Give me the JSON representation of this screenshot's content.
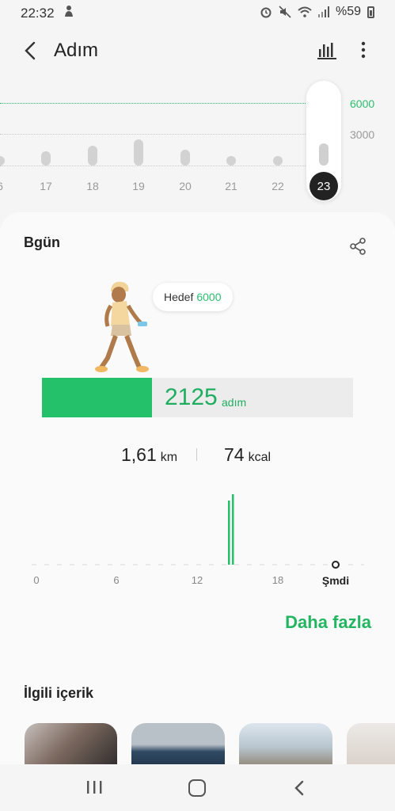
{
  "status_bar": {
    "time": "22:32",
    "battery_text": "%59"
  },
  "header": {
    "title": "Adım",
    "icons": [
      "back-arrow-icon",
      "bar-chart-icon",
      "more-vert-icon"
    ]
  },
  "weekly": {
    "goal_label": "6000",
    "mid_label": "3000",
    "days": [
      {
        "label": "6",
        "steps": 250
      },
      {
        "label": "17",
        "steps": 1400
      },
      {
        "label": "18",
        "steps": 1900
      },
      {
        "label": "19",
        "steps": 2500
      },
      {
        "label": "20",
        "steps": 1500
      },
      {
        "label": "21",
        "steps": 150
      },
      {
        "label": "22",
        "steps": 150
      },
      {
        "label": "23",
        "steps": 2125,
        "selected": true
      }
    ]
  },
  "today": {
    "title": "Bgün",
    "goal_text": "Hedef",
    "goal_value": "6000",
    "steps": "2125",
    "steps_unit": "adım",
    "progress_fraction": 0.354,
    "distance_value": "1,61",
    "distance_unit": "km",
    "calories_value": "74",
    "calories_unit": "kcal",
    "hour_ticks": [
      "0",
      "6",
      "12",
      "18"
    ],
    "now_label": "Şmdi",
    "more_link": "Daha fazla"
  },
  "related": {
    "title": "İlgili içerik"
  },
  "colors": {
    "accent": "#24c16a",
    "accent_text": "#1fae5f",
    "selected_day_bg": "#222222"
  }
}
